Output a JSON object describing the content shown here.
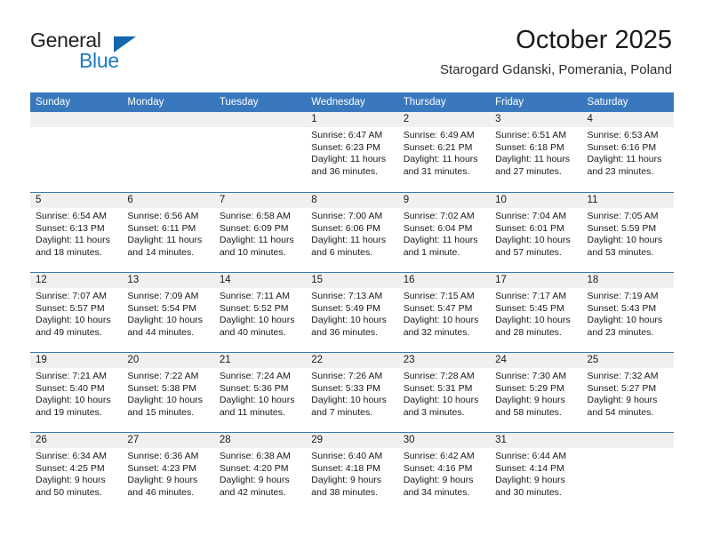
{
  "brand": {
    "word_one": "General",
    "word_two": "Blue",
    "triangle_color": "#1566b0",
    "blue_text_color": "#1b7bc4"
  },
  "header": {
    "month_title": "October 2025",
    "location": "Starogard Gdanski, Pomerania, Poland"
  },
  "theme": {
    "header_blue": "#3a78bd",
    "daynum_band": "#f0f0f0",
    "row_rule": "#3a78bd"
  },
  "weekday_headers": [
    "Sunday",
    "Monday",
    "Tuesday",
    "Wednesday",
    "Thursday",
    "Friday",
    "Saturday"
  ],
  "weeks": [
    [
      {
        "day": "",
        "empty": true,
        "sunrise": "",
        "sunset": "",
        "daylight_line1": "",
        "daylight_line2": ""
      },
      {
        "day": "",
        "empty": true,
        "sunrise": "",
        "sunset": "",
        "daylight_line1": "",
        "daylight_line2": ""
      },
      {
        "day": "",
        "empty": true,
        "sunrise": "",
        "sunset": "",
        "daylight_line1": "",
        "daylight_line2": ""
      },
      {
        "day": "1",
        "empty": false,
        "sunrise": "Sunrise: 6:47 AM",
        "sunset": "Sunset: 6:23 PM",
        "daylight_line1": "Daylight: 11 hours",
        "daylight_line2": "and 36 minutes."
      },
      {
        "day": "2",
        "empty": false,
        "sunrise": "Sunrise: 6:49 AM",
        "sunset": "Sunset: 6:21 PM",
        "daylight_line1": "Daylight: 11 hours",
        "daylight_line2": "and 31 minutes."
      },
      {
        "day": "3",
        "empty": false,
        "sunrise": "Sunrise: 6:51 AM",
        "sunset": "Sunset: 6:18 PM",
        "daylight_line1": "Daylight: 11 hours",
        "daylight_line2": "and 27 minutes."
      },
      {
        "day": "4",
        "empty": false,
        "sunrise": "Sunrise: 6:53 AM",
        "sunset": "Sunset: 6:16 PM",
        "daylight_line1": "Daylight: 11 hours",
        "daylight_line2": "and 23 minutes."
      }
    ],
    [
      {
        "day": "5",
        "empty": false,
        "sunrise": "Sunrise: 6:54 AM",
        "sunset": "Sunset: 6:13 PM",
        "daylight_line1": "Daylight: 11 hours",
        "daylight_line2": "and 18 minutes."
      },
      {
        "day": "6",
        "empty": false,
        "sunrise": "Sunrise: 6:56 AM",
        "sunset": "Sunset: 6:11 PM",
        "daylight_line1": "Daylight: 11 hours",
        "daylight_line2": "and 14 minutes."
      },
      {
        "day": "7",
        "empty": false,
        "sunrise": "Sunrise: 6:58 AM",
        "sunset": "Sunset: 6:09 PM",
        "daylight_line1": "Daylight: 11 hours",
        "daylight_line2": "and 10 minutes."
      },
      {
        "day": "8",
        "empty": false,
        "sunrise": "Sunrise: 7:00 AM",
        "sunset": "Sunset: 6:06 PM",
        "daylight_line1": "Daylight: 11 hours",
        "daylight_line2": "and 6 minutes."
      },
      {
        "day": "9",
        "empty": false,
        "sunrise": "Sunrise: 7:02 AM",
        "sunset": "Sunset: 6:04 PM",
        "daylight_line1": "Daylight: 11 hours",
        "daylight_line2": "and 1 minute."
      },
      {
        "day": "10",
        "empty": false,
        "sunrise": "Sunrise: 7:04 AM",
        "sunset": "Sunset: 6:01 PM",
        "daylight_line1": "Daylight: 10 hours",
        "daylight_line2": "and 57 minutes."
      },
      {
        "day": "11",
        "empty": false,
        "sunrise": "Sunrise: 7:05 AM",
        "sunset": "Sunset: 5:59 PM",
        "daylight_line1": "Daylight: 10 hours",
        "daylight_line2": "and 53 minutes."
      }
    ],
    [
      {
        "day": "12",
        "empty": false,
        "sunrise": "Sunrise: 7:07 AM",
        "sunset": "Sunset: 5:57 PM",
        "daylight_line1": "Daylight: 10 hours",
        "daylight_line2": "and 49 minutes."
      },
      {
        "day": "13",
        "empty": false,
        "sunrise": "Sunrise: 7:09 AM",
        "sunset": "Sunset: 5:54 PM",
        "daylight_line1": "Daylight: 10 hours",
        "daylight_line2": "and 44 minutes."
      },
      {
        "day": "14",
        "empty": false,
        "sunrise": "Sunrise: 7:11 AM",
        "sunset": "Sunset: 5:52 PM",
        "daylight_line1": "Daylight: 10 hours",
        "daylight_line2": "and 40 minutes."
      },
      {
        "day": "15",
        "empty": false,
        "sunrise": "Sunrise: 7:13 AM",
        "sunset": "Sunset: 5:49 PM",
        "daylight_line1": "Daylight: 10 hours",
        "daylight_line2": "and 36 minutes."
      },
      {
        "day": "16",
        "empty": false,
        "sunrise": "Sunrise: 7:15 AM",
        "sunset": "Sunset: 5:47 PM",
        "daylight_line1": "Daylight: 10 hours",
        "daylight_line2": "and 32 minutes."
      },
      {
        "day": "17",
        "empty": false,
        "sunrise": "Sunrise: 7:17 AM",
        "sunset": "Sunset: 5:45 PM",
        "daylight_line1": "Daylight: 10 hours",
        "daylight_line2": "and 28 minutes."
      },
      {
        "day": "18",
        "empty": false,
        "sunrise": "Sunrise: 7:19 AM",
        "sunset": "Sunset: 5:43 PM",
        "daylight_line1": "Daylight: 10 hours",
        "daylight_line2": "and 23 minutes."
      }
    ],
    [
      {
        "day": "19",
        "empty": false,
        "sunrise": "Sunrise: 7:21 AM",
        "sunset": "Sunset: 5:40 PM",
        "daylight_line1": "Daylight: 10 hours",
        "daylight_line2": "and 19 minutes."
      },
      {
        "day": "20",
        "empty": false,
        "sunrise": "Sunrise: 7:22 AM",
        "sunset": "Sunset: 5:38 PM",
        "daylight_line1": "Daylight: 10 hours",
        "daylight_line2": "and 15 minutes."
      },
      {
        "day": "21",
        "empty": false,
        "sunrise": "Sunrise: 7:24 AM",
        "sunset": "Sunset: 5:36 PM",
        "daylight_line1": "Daylight: 10 hours",
        "daylight_line2": "and 11 minutes."
      },
      {
        "day": "22",
        "empty": false,
        "sunrise": "Sunrise: 7:26 AM",
        "sunset": "Sunset: 5:33 PM",
        "daylight_line1": "Daylight: 10 hours",
        "daylight_line2": "and 7 minutes."
      },
      {
        "day": "23",
        "empty": false,
        "sunrise": "Sunrise: 7:28 AM",
        "sunset": "Sunset: 5:31 PM",
        "daylight_line1": "Daylight: 10 hours",
        "daylight_line2": "and 3 minutes."
      },
      {
        "day": "24",
        "empty": false,
        "sunrise": "Sunrise: 7:30 AM",
        "sunset": "Sunset: 5:29 PM",
        "daylight_line1": "Daylight: 9 hours",
        "daylight_line2": "and 58 minutes."
      },
      {
        "day": "25",
        "empty": false,
        "sunrise": "Sunrise: 7:32 AM",
        "sunset": "Sunset: 5:27 PM",
        "daylight_line1": "Daylight: 9 hours",
        "daylight_line2": "and 54 minutes."
      }
    ],
    [
      {
        "day": "26",
        "empty": false,
        "sunrise": "Sunrise: 6:34 AM",
        "sunset": "Sunset: 4:25 PM",
        "daylight_line1": "Daylight: 9 hours",
        "daylight_line2": "and 50 minutes."
      },
      {
        "day": "27",
        "empty": false,
        "sunrise": "Sunrise: 6:36 AM",
        "sunset": "Sunset: 4:23 PM",
        "daylight_line1": "Daylight: 9 hours",
        "daylight_line2": "and 46 minutes."
      },
      {
        "day": "28",
        "empty": false,
        "sunrise": "Sunrise: 6:38 AM",
        "sunset": "Sunset: 4:20 PM",
        "daylight_line1": "Daylight: 9 hours",
        "daylight_line2": "and 42 minutes."
      },
      {
        "day": "29",
        "empty": false,
        "sunrise": "Sunrise: 6:40 AM",
        "sunset": "Sunset: 4:18 PM",
        "daylight_line1": "Daylight: 9 hours",
        "daylight_line2": "and 38 minutes."
      },
      {
        "day": "30",
        "empty": false,
        "sunrise": "Sunrise: 6:42 AM",
        "sunset": "Sunset: 4:16 PM",
        "daylight_line1": "Daylight: 9 hours",
        "daylight_line2": "and 34 minutes."
      },
      {
        "day": "31",
        "empty": false,
        "sunrise": "Sunrise: 6:44 AM",
        "sunset": "Sunset: 4:14 PM",
        "daylight_line1": "Daylight: 9 hours",
        "daylight_line2": "and 30 minutes."
      },
      {
        "day": "",
        "empty": true,
        "sunrise": "",
        "sunset": "",
        "daylight_line1": "",
        "daylight_line2": ""
      }
    ]
  ]
}
